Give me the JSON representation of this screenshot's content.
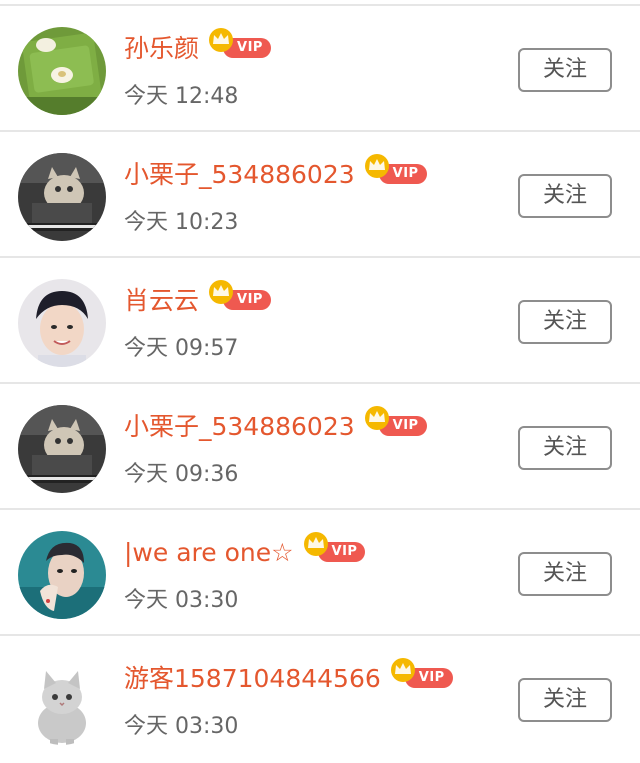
{
  "vip_label": "VIP",
  "follow_label": "关注",
  "colors": {
    "name": "#e4572e",
    "vip_tag": "#ef5950",
    "vip_crown": "#f5b800",
    "time": "#666666",
    "divider": "#e6e6e6"
  },
  "users": [
    {
      "name": "孙乐颜",
      "time": "今天 12:48",
      "avatar": "green-food-photo"
    },
    {
      "name": "小栗子_534886023",
      "time": "今天 10:23",
      "avatar": "cat-meme-photo"
    },
    {
      "name": "肖云云",
      "time": "今天 09:57",
      "avatar": "smiling-man-photo"
    },
    {
      "name": "小栗子_534886023",
      "time": "今天 09:36",
      "avatar": "cat-meme-photo"
    },
    {
      "name": "|we are one☆",
      "time": "今天 03:30",
      "avatar": "teal-portrait-photo"
    },
    {
      "name": "游客1587104844566",
      "time": "今天 03:30",
      "avatar": "gray-kitten-photo"
    }
  ]
}
